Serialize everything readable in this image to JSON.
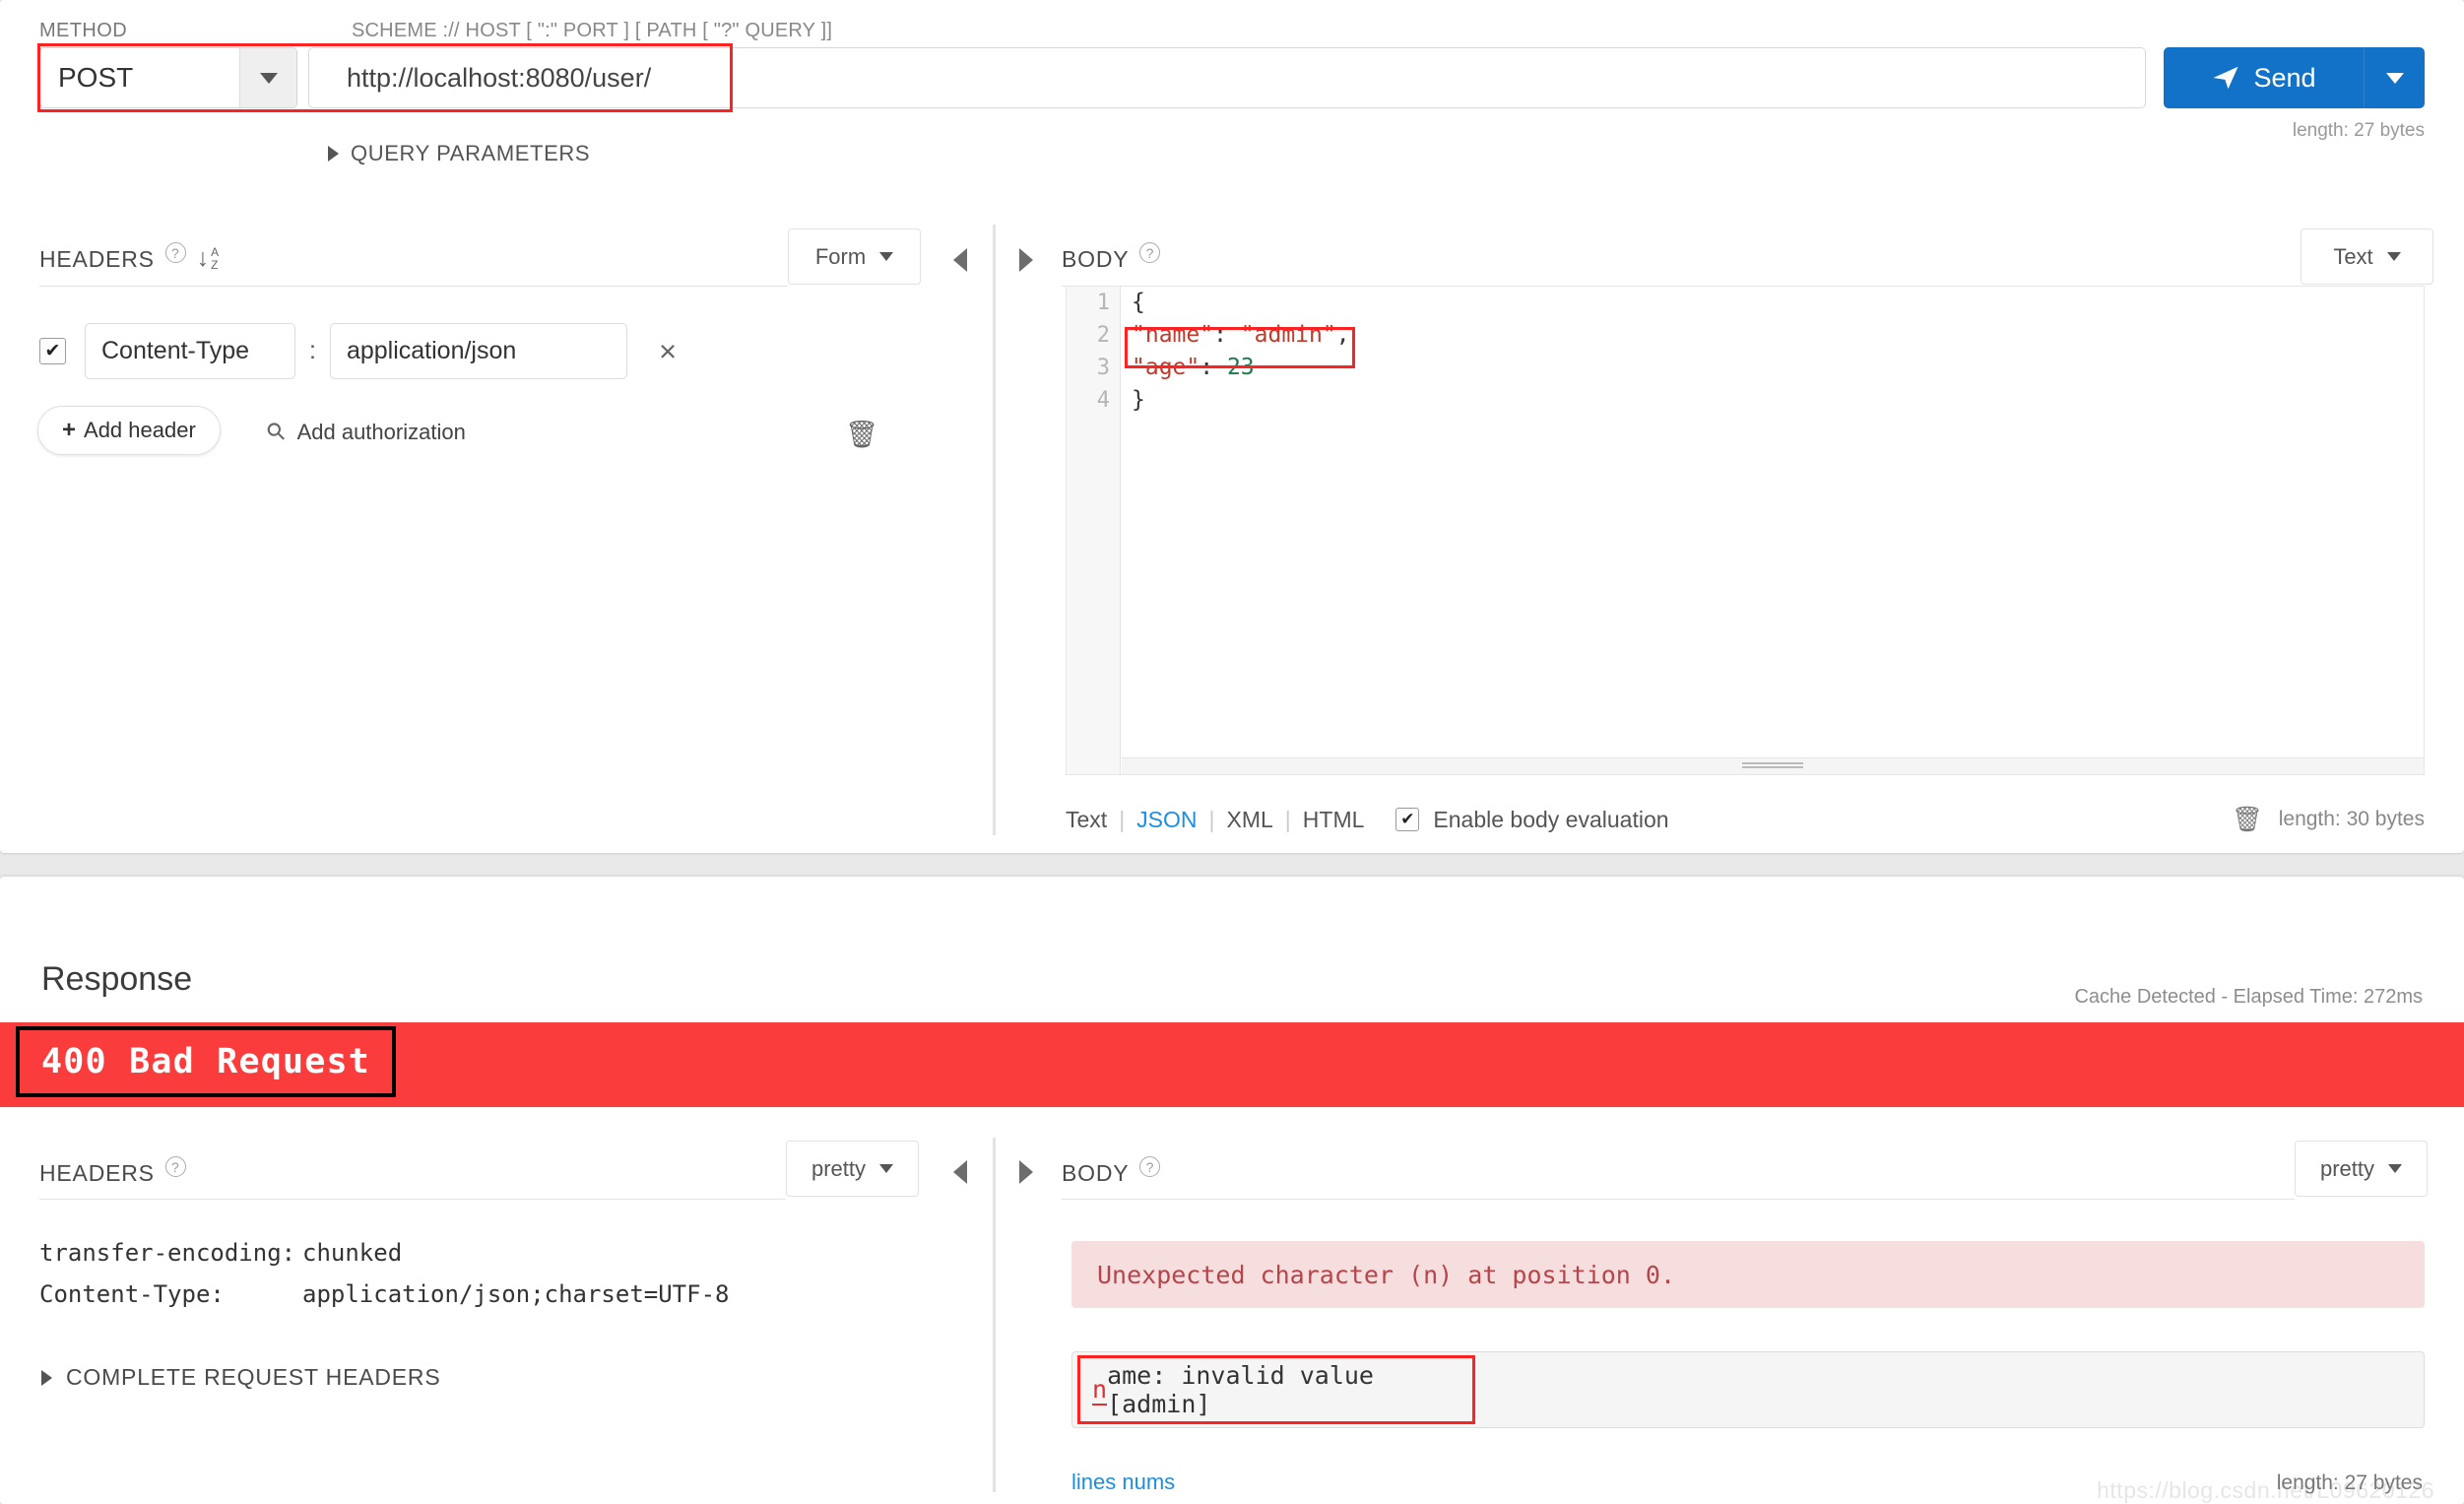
{
  "request": {
    "labels": {
      "method": "METHOD",
      "scheme": "SCHEME :// HOST [ \":\" PORT ] [ PATH [ \"?\" QUERY ]]",
      "query_parameters": "QUERY PARAMETERS"
    },
    "method": "POST",
    "url": "http://localhost:8080/user/",
    "send_label": "Send",
    "send_icon": "paper-plane-icon",
    "url_length": "length: 27 bytes",
    "headers": {
      "title": "HEADERS",
      "sort_icon": "sort-alpha-asc-icon",
      "mode": "Form",
      "rows": [
        {
          "enabled": true,
          "key": "Content-Type",
          "value": "application/json",
          "separator": ":",
          "remove": "×"
        }
      ],
      "add_header": "Add header",
      "add_authorization": "Add authorization",
      "clear_icon": "trash-icon"
    },
    "body": {
      "title": "BODY",
      "mode": "Text",
      "line_numbers": [
        "1",
        "2",
        "3",
        "4"
      ],
      "lines": [
        {
          "tokens": [
            {
              "t": "{",
              "k": "punct"
            }
          ]
        },
        {
          "tokens": [
            {
              "t": "\"name\"",
              "k": "str"
            },
            {
              "t": ": ",
              "k": "punct"
            },
            {
              "t": "\"admin\"",
              "k": "str"
            },
            {
              "t": ",",
              "k": "punct"
            }
          ]
        },
        {
          "tokens": [
            {
              "t": "\"age\"",
              "k": "str"
            },
            {
              "t": ": ",
              "k": "punct"
            },
            {
              "t": "23",
              "k": "num"
            }
          ]
        },
        {
          "tokens": [
            {
              "t": "}",
              "k": "punct"
            }
          ]
        }
      ],
      "formats": [
        "Text",
        "JSON",
        "XML",
        "HTML"
      ],
      "active_format": "JSON",
      "enable_body_evaluation": "Enable body evaluation",
      "evaluation_checked": true,
      "clear_icon": "trash-icon",
      "length": "length: 30 bytes"
    }
  },
  "response": {
    "title": "Response",
    "meta": "Cache Detected - Elapsed Time: 272ms",
    "status": "400 Bad Request",
    "status_color": "#fa3c3c",
    "headers": {
      "title": "HEADERS",
      "mode": "pretty",
      "rows": [
        {
          "key": "transfer-encoding:",
          "value": "chunked"
        },
        {
          "key": "Content-Type:",
          "value": "application/json;charset=UTF-8"
        }
      ],
      "complete_request_headers": "COMPLETE REQUEST HEADERS"
    },
    "body": {
      "title": "BODY",
      "mode": "pretty",
      "error_message": "Unexpected character (n) at position 0.",
      "value_line_prefix": "n",
      "value_line_rest": "ame: invalid value [admin]",
      "lines_nums_link": "lines nums",
      "length": "length: 27 bytes"
    }
  },
  "watermark": "https://blog.csdn.net/L09620126"
}
